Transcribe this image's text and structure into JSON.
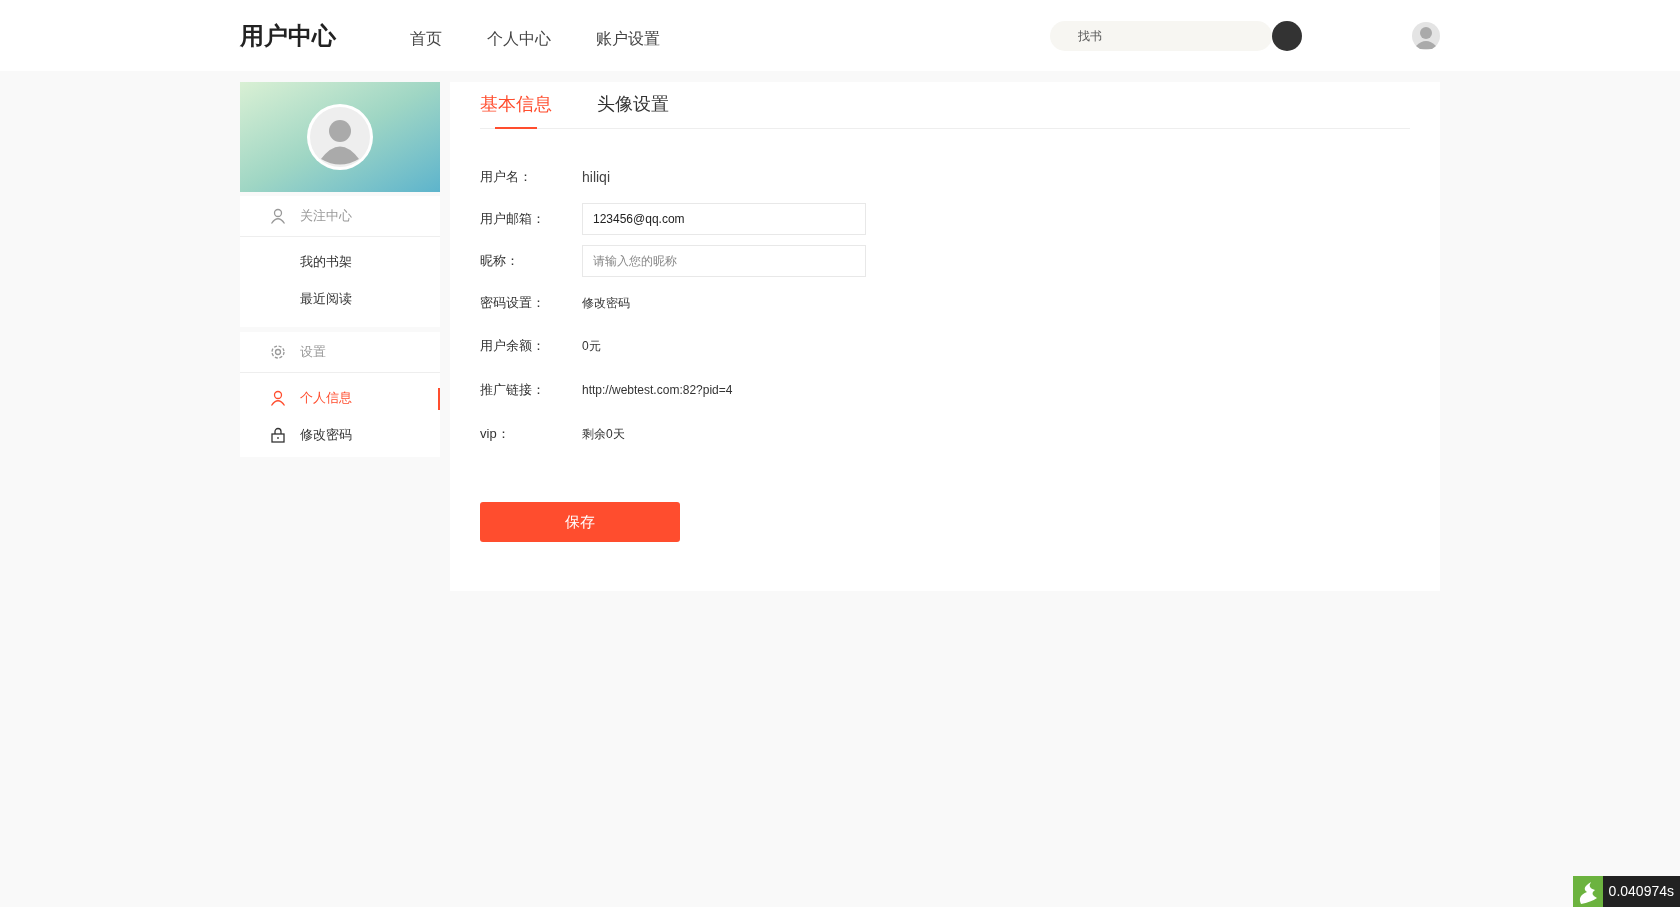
{
  "header": {
    "logo": "用户中心",
    "nav": [
      {
        "label": "首页"
      },
      {
        "label": "个人中心"
      },
      {
        "label": "账户设置"
      }
    ],
    "search": {
      "placeholder": "找书"
    }
  },
  "sidebar": {
    "groups": [
      {
        "title": "关注中心",
        "items": [
          {
            "label": "我的书架",
            "selected": false
          },
          {
            "label": "最近阅读",
            "selected": false
          }
        ]
      },
      {
        "title": "设置",
        "items": [
          {
            "label": "个人信息",
            "selected": true
          },
          {
            "label": "修改密码",
            "selected": false
          }
        ]
      }
    ]
  },
  "tabs": [
    {
      "label": "基本信息",
      "selected": true
    },
    {
      "label": "头像设置",
      "selected": false
    }
  ],
  "form": [
    {
      "kind": "text",
      "label": "用户名：",
      "value": "hiliqi"
    },
    {
      "kind": "input",
      "label": "用户邮箱：",
      "value": "123456@qq.com"
    },
    {
      "kind": "input",
      "label": "昵称：",
      "placeholder": "请输入您的昵称"
    },
    {
      "kind": "link",
      "label": "密码设置：",
      "value": "修改密码"
    },
    {
      "kind": "small",
      "label": "用户余额：",
      "value": "0元"
    },
    {
      "kind": "small",
      "label": "推广链接：",
      "value": "http://webtest.com:82?pid=4"
    },
    {
      "kind": "small",
      "label": "vip：",
      "value": "剩余0天"
    }
  ],
  "save_button": "保存",
  "debug_badge": "0.040974s"
}
